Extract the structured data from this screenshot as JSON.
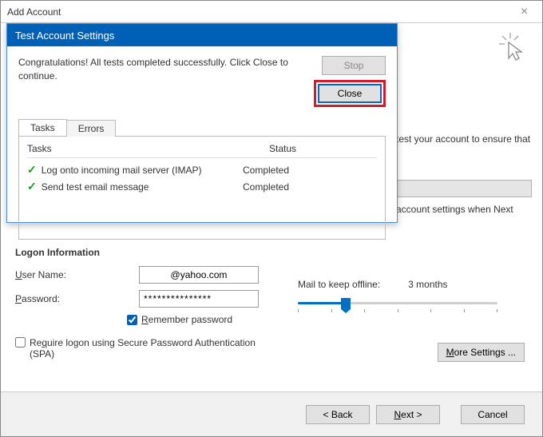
{
  "main": {
    "title": "Add Account",
    "logon_heading": "Logon Information",
    "username_label": "User Name:",
    "username_value": "@yahoo.com",
    "password_label": "Password:",
    "password_value": "***************",
    "remember_label": "Remember password",
    "spa_label": "Require logon using Secure Password Authentication (SPA)",
    "right_info": "test your account to ensure that",
    "auto_test": "account settings when Next",
    "mail_offline_label": "Mail to keep offline:",
    "mail_offline_value": "3 months",
    "more_settings": "More Settings ...",
    "back": "< Back",
    "next": "Next >",
    "cancel": "Cancel"
  },
  "dialog": {
    "title": "Test Account Settings",
    "message": "Congratulations! All tests completed successfully. Click Close to continue.",
    "stop": "Stop",
    "close": "Close",
    "tab_tasks": "Tasks",
    "tab_errors": "Errors",
    "col_tasks": "Tasks",
    "col_status": "Status",
    "rows": [
      {
        "task": "Log onto incoming mail server (IMAP)",
        "status": "Completed"
      },
      {
        "task": "Send test email message",
        "status": "Completed"
      }
    ]
  }
}
